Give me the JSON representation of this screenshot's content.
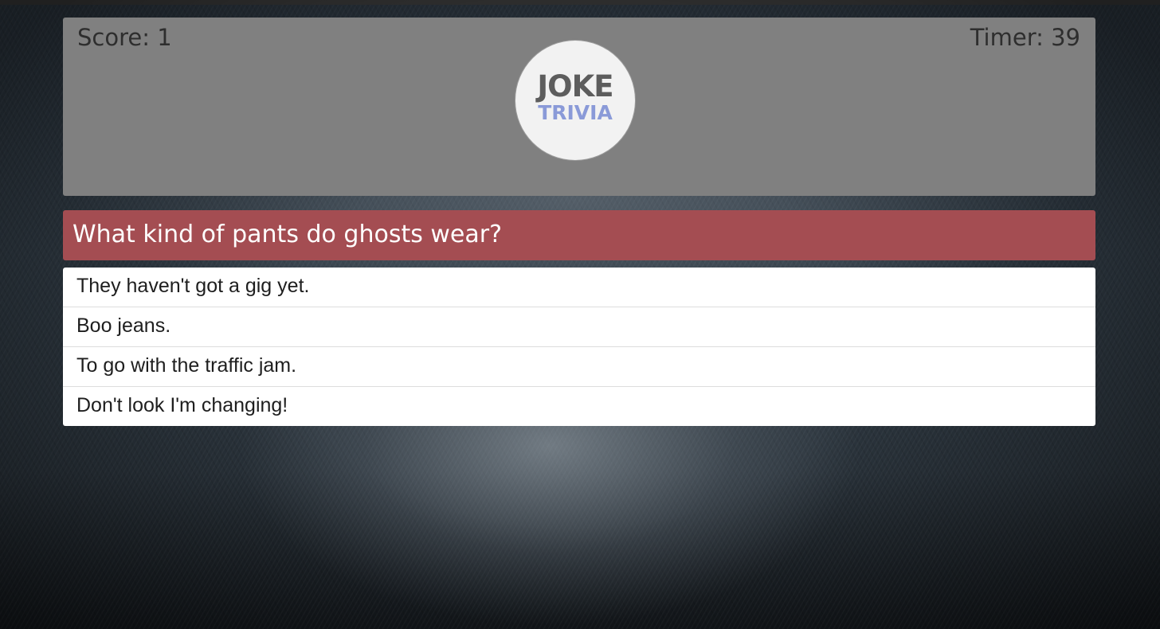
{
  "header": {
    "score_label": "Score: 1",
    "timer_label": "Timer: 39",
    "logo": {
      "line1": "JOKE",
      "line2": "TRIVIA"
    }
  },
  "question": {
    "text": "What kind of pants do ghosts wear?"
  },
  "answers": [
    {
      "text": "They haven't got a gig yet."
    },
    {
      "text": "Boo jeans."
    },
    {
      "text": "To go with the traffic jam."
    },
    {
      "text": "Don't look I'm changing!"
    }
  ],
  "colors": {
    "header_panel": "#808080",
    "question_bar": "#a44d52",
    "logo_joke": "#5d5d5d",
    "logo_trivia": "#8a9ad8"
  }
}
